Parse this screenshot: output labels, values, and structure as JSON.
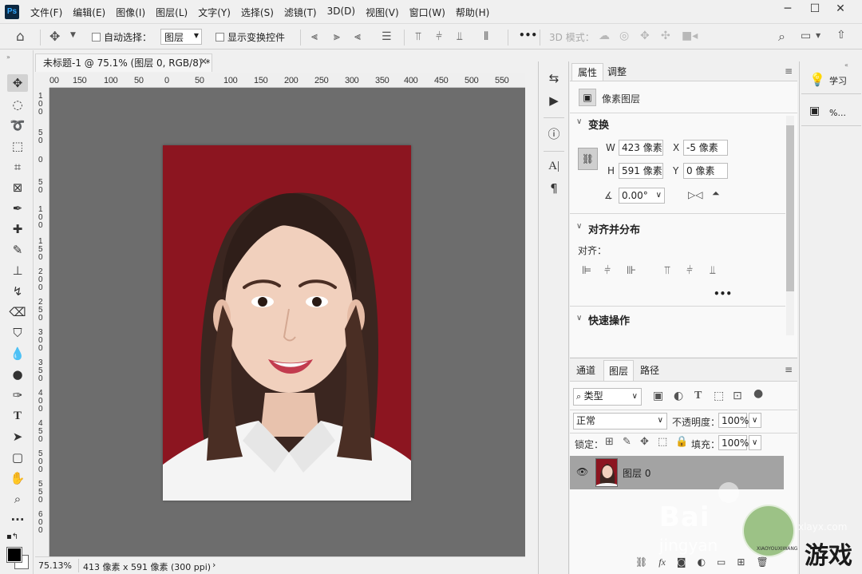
{
  "app": {
    "logo": "Ps"
  },
  "menu": [
    "文件(F)",
    "编辑(E)",
    "图像(I)",
    "图层(L)",
    "文字(Y)",
    "选择(S)",
    "滤镜(T)",
    "3D(D)",
    "视图(V)",
    "窗口(W)",
    "帮助(H)"
  ],
  "options": {
    "auto_select_label": "自动选择：",
    "auto_select_value": "图层",
    "show_transform_label": "显示变换控件",
    "more_label": "•••",
    "mode_3d_label": "3D 模式："
  },
  "document": {
    "tab_title": "未标题-1 @ 75.1% (图层 0, RGB/8) *",
    "ruler_h": [
      "00",
      "150",
      "100",
      "50",
      "0",
      "50",
      "100",
      "150",
      "200",
      "250",
      "300",
      "350",
      "400",
      "450",
      "500",
      "550"
    ],
    "ruler_v": [
      "1\n0\n0",
      "5\n0",
      "0",
      "5\n0",
      "1\n0\n0",
      "1\n5\n0",
      "2\n0\n0",
      "2\n5\n0",
      "3\n0\n0",
      "3\n5\n0",
      "4\n0\n0",
      "4\n5\n0",
      "5\n0\n0",
      "5\n5\n0",
      "6\n0\n0"
    ],
    "zoom": "75.13%",
    "doc_info": "413 像素 x 591 像素 (300 ppi)",
    "background_color": "#8c1520"
  },
  "properties": {
    "tabs": [
      "属性",
      "调整"
    ],
    "layer_type": "像素图层",
    "transform_title": "变换",
    "w_label": "W",
    "w_value": "423 像素",
    "x_label": "X",
    "x_value": "-5 像素",
    "h_label": "H",
    "h_value": "591 像素",
    "y_label": "Y",
    "y_value": "0 像素",
    "angle_value": "0.00°",
    "align_title": "对齐并分布",
    "align_label": "对齐：",
    "quick_title": "快速操作"
  },
  "layers": {
    "tabs": [
      "通道",
      "图层",
      "路径"
    ],
    "filter_label": "类型",
    "blend_mode": "正常",
    "opacity_label": "不透明度：",
    "opacity_value": "100%",
    "lock_label": "锁定：",
    "fill_label": "填充：",
    "fill_value": "100%",
    "layer_name": "图层 0"
  },
  "right_panel": {
    "learn_label": "学习",
    "pct_label": "%..."
  },
  "watermark": {
    "baidu": "Bai",
    "jingyan": "jingyan",
    "site": "xlayx.com",
    "game": "游戏",
    "sub": "XIAOYOUXIWANG"
  }
}
